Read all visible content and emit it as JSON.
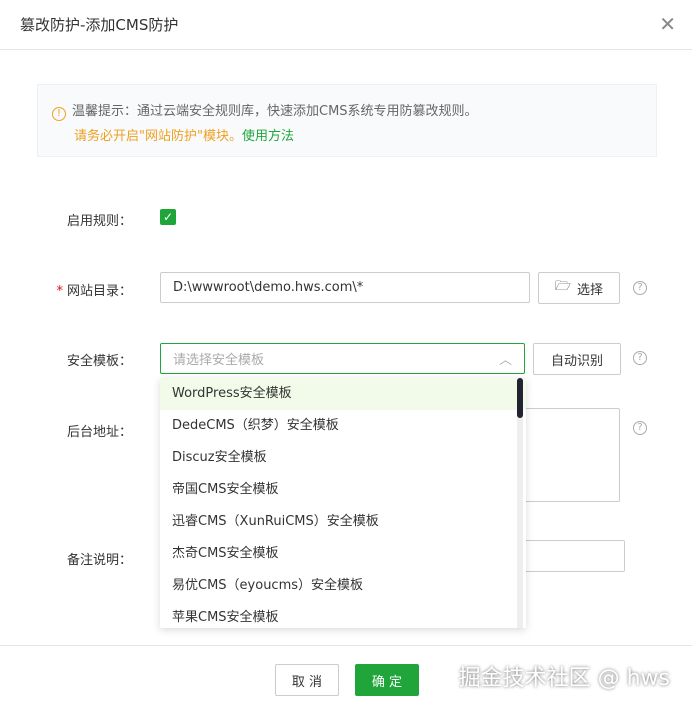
{
  "title": "篡改防护-添加CMS防护",
  "tip": {
    "line1": "温馨提示：通过云端安全规则库，快速添加CMS系统专用防篡改规则。",
    "line2": "请务必开启\"网站防护\"模块。",
    "link": "使用方法"
  },
  "form": {
    "enable_label": "启用规则：",
    "dir_label": "网站目录：",
    "dir_value": "D:\\wwwroot\\demo.hws.com\\*",
    "choose": "选择",
    "tpl_label": "安全模板：",
    "tpl_placeholder": "请选择安全模板",
    "auto": "自动识别",
    "admin_label": "后台地址：",
    "note_label": "备注说明："
  },
  "options": [
    "WordPress安全模板",
    "DedeCMS（织梦）安全模板",
    "Discuz安全模板",
    "帝国CMS安全模板",
    "迅睿CMS（XunRuiCMS）安全模板",
    "杰奇CMS安全模板",
    "易优CMS（eyoucms）安全模板",
    "苹果CMS安全模板"
  ],
  "footer": {
    "cancel": "取 消",
    "ok": "确 定"
  },
  "watermark": "掘金技术社区 @ hws"
}
